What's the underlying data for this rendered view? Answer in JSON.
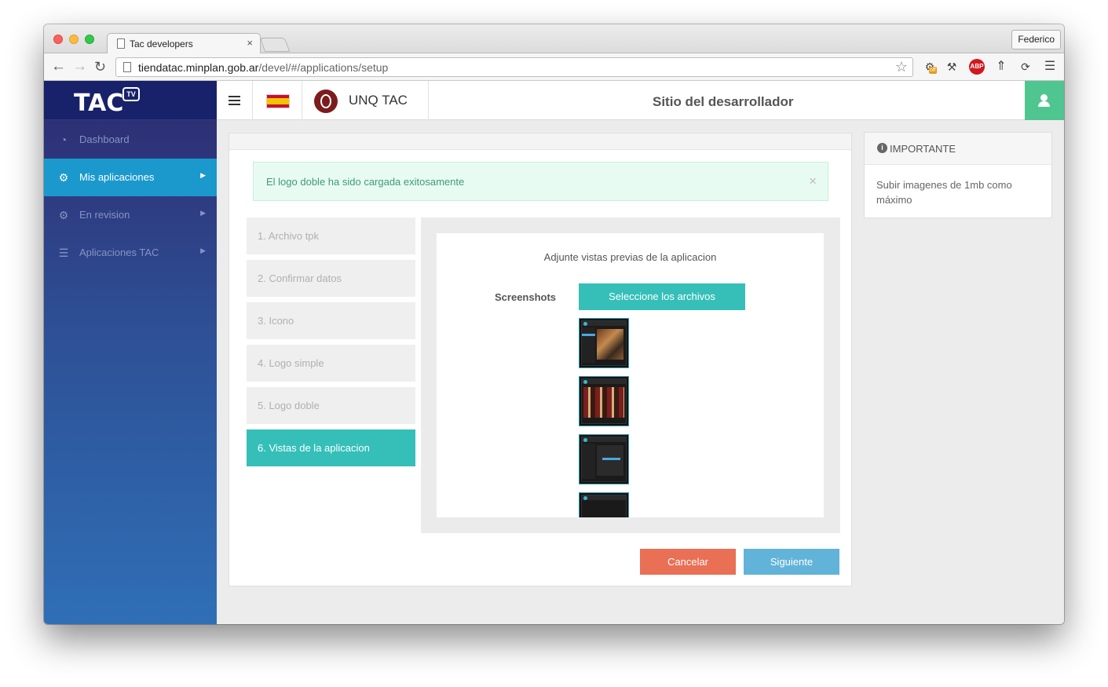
{
  "browser": {
    "tab_title": "Tac developers",
    "tab_close": "×",
    "profile": "Federico",
    "url_host": "tiendatac.minplan.gob.ar",
    "url_path": "/devel/#/applications/setup",
    "ext_abp": "ABP",
    "ext_badge": "off"
  },
  "sidebar": {
    "logo": "TAC",
    "logo_badge": "TV",
    "items": [
      {
        "label": "Dashboard",
        "icon": "dashboard-icon"
      },
      {
        "label": "Mis aplicaciones",
        "icon": "gears-icon",
        "active": true
      },
      {
        "label": "En revision",
        "icon": "gears-icon"
      },
      {
        "label": "Aplicaciones TAC",
        "icon": "server-icon"
      }
    ]
  },
  "header": {
    "org_name": "UNQ TAC",
    "site_title": "Sitio del desarrollador"
  },
  "alert": {
    "message": "El logo doble ha sido cargada exitosamente",
    "close": "×"
  },
  "steps": [
    {
      "label": "1. Archivo tpk"
    },
    {
      "label": "2. Confirmar datos"
    },
    {
      "label": "3. Icono"
    },
    {
      "label": "4. Logo simple"
    },
    {
      "label": "5. Logo doble"
    },
    {
      "label": "6. Vistas de la aplicacion",
      "active": true
    }
  ],
  "content": {
    "title": "Adjunte vistas previas de la aplicacion",
    "screenshots_label": "Screenshots",
    "select_button": "Seleccione los archivos"
  },
  "actions": {
    "cancel": "Cancelar",
    "next": "Siguiente"
  },
  "info": {
    "title": "IMPORTANTE",
    "body": "Subir imagenes de 1mb como máximo"
  },
  "colors": {
    "accent": "#35bfb8",
    "active_nav": "#1b99cd",
    "cancel": "#e96f55",
    "next": "#62b3d9",
    "user": "#4fc58f"
  }
}
